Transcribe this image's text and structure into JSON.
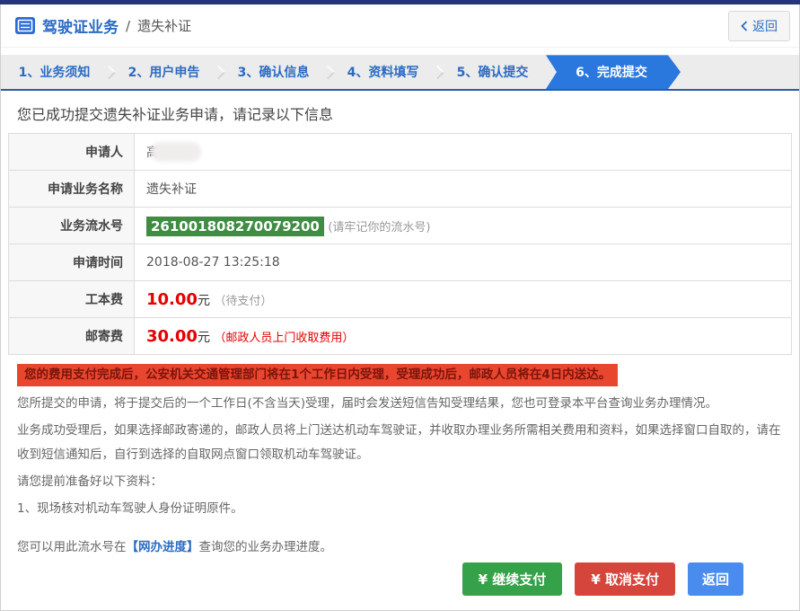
{
  "header": {
    "title": "驾驶证业务",
    "separator": "/",
    "subtitle": "遗失补证",
    "back_chevron": "〈",
    "back_button": "返回"
  },
  "steps": {
    "items": [
      {
        "label": "1、业务须知",
        "active": false
      },
      {
        "label": "2、用户申告",
        "active": false
      },
      {
        "label": "3、确认信息",
        "active": false
      },
      {
        "label": "4、资料填写",
        "active": false
      },
      {
        "label": "5、确认提交",
        "active": false
      },
      {
        "label": "6、完成提交",
        "active": true
      }
    ]
  },
  "main": {
    "success_message": "您已成功提交遗失补证业务申请，请记录以下信息",
    "info_table": {
      "rows": [
        {
          "label": "申请人",
          "value": "高"
        },
        {
          "label": "申请业务名称",
          "value": "遗失补证"
        },
        {
          "label": "业务流水号",
          "serial": "261001808270079200",
          "note": "(请牢记你的流水号)"
        },
        {
          "label": "申请时间",
          "value": "2018-08-27 13:25:18"
        },
        {
          "label": "工本费",
          "amount": "10.00",
          "unit": "元",
          "note": "（待支付）"
        },
        {
          "label": "邮寄费",
          "amount": "30.00",
          "unit": "元",
          "note": "（邮政人员上门收取费用）"
        }
      ]
    },
    "alert_banner": "您的费用支付完成后，公安机关交通管理部门将在1个工作日内受理，受理成功后，邮政人员将在4日内送达。",
    "paragraphs": [
      "您所提交的申请，将于提交后的一个工作日(不含当天)受理，届时会发送短信告知受理结果，您也可登录本平台查询业务办理情况。",
      "业务成功受理后，如果选择邮政寄递的，邮政人员将上门送达机动车驾驶证，并收取办理业务所需相关费用和资料，如果选择窗口自取的，请在收到短信通知后，自行到选择的自取网点窗口领取机动车驾驶证。"
    ],
    "materials_heading": "请您提前准备好以下资料：",
    "materials": [
      "1、现场核对机动车驾驶人身份证明原件。"
    ],
    "progress_note": {
      "prefix": "您可以用此流水号在",
      "link": "【网办进度】",
      "suffix": "查询您的业务办理进度。"
    }
  },
  "footer": {
    "continue_payment": "¥ 继续支付",
    "cancel_payment": "¥ 取消支付",
    "return_label": "返回"
  },
  "colors": {
    "accent_blue": "#2b6bc4",
    "active_step_blue": "#2a77dd",
    "topbar_navy": "#24357e",
    "serial_green": "#3f8c42",
    "banner_red_bg": "#e8462e",
    "banner_red_text": "#7b140b",
    "fee_red": "#e60000",
    "btn_green": "#35a24a",
    "btn_red": "#d6453c",
    "btn_blue": "#4a8cee"
  }
}
